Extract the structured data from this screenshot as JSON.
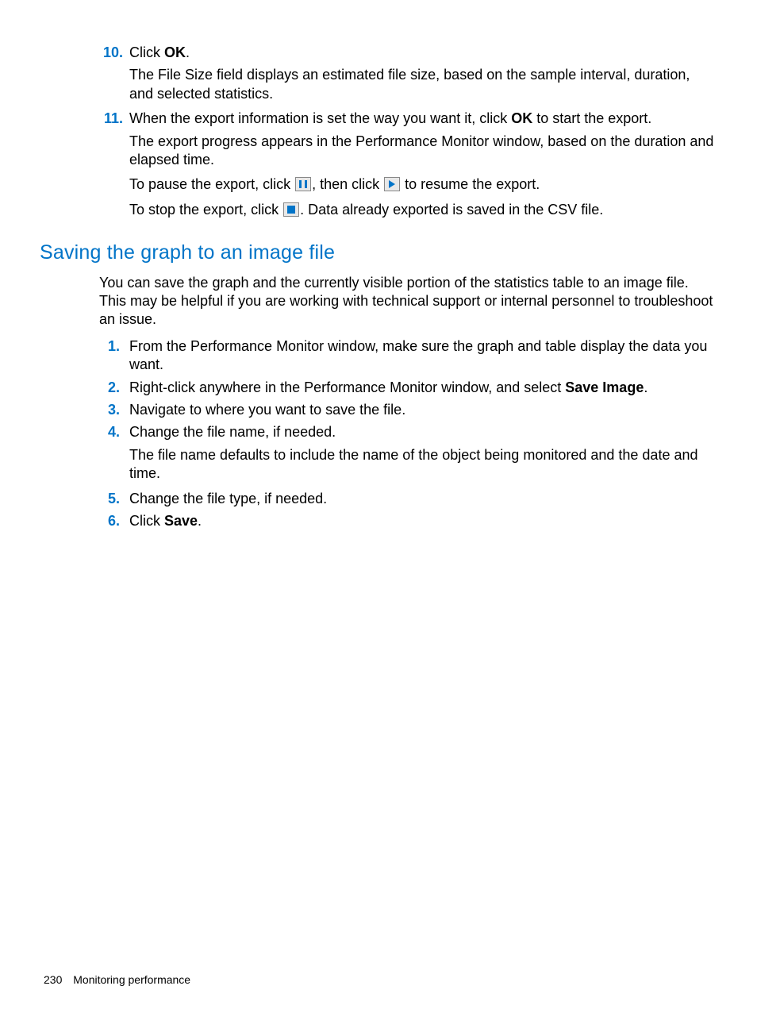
{
  "list1": {
    "item10": {
      "num": "10.",
      "line_pre": "Click ",
      "line_bold": "OK",
      "line_post": ".",
      "para": "The File Size field displays an estimated file size, based on the sample interval, duration, and selected statistics."
    },
    "item11": {
      "num": "11.",
      "line_pre": "When the export information is set the way you want it, click ",
      "line_bold": "OK",
      "line_post": " to start the export.",
      "para1": "The export progress appears in the Performance Monitor window, based on the duration and elapsed time.",
      "pause_pre": "To pause the export, click ",
      "pause_mid": ", then click ",
      "pause_post": " to resume the export.",
      "stop_pre": "To stop the export, click ",
      "stop_post": ". Data already exported is saved in the CSV file."
    }
  },
  "heading": "Saving the graph to an image file",
  "intro": "You can save the graph and the currently visible portion of the statistics table to an image file. This may be helpful if you are working with technical support or internal personnel to troubleshoot an issue.",
  "list2": {
    "item1": {
      "num": "1.",
      "text": "From the Performance Monitor window, make sure the graph and table display the data you want."
    },
    "item2": {
      "num": "2.",
      "pre": "Right-click anywhere in the Performance Monitor window, and select ",
      "bold": "Save Image",
      "post": "."
    },
    "item3": {
      "num": "3.",
      "text": "Navigate to where you want to save the file."
    },
    "item4": {
      "num": "4.",
      "text": "Change the file name, if needed.",
      "para": "The file name defaults to include the name of the object being monitored and the date and time."
    },
    "item5": {
      "num": "5.",
      "text": "Change the file type, if needed."
    },
    "item6": {
      "num": "6.",
      "pre": "Click ",
      "bold": "Save",
      "post": "."
    }
  },
  "footer": {
    "page": "230",
    "chapter": "Monitoring performance"
  }
}
